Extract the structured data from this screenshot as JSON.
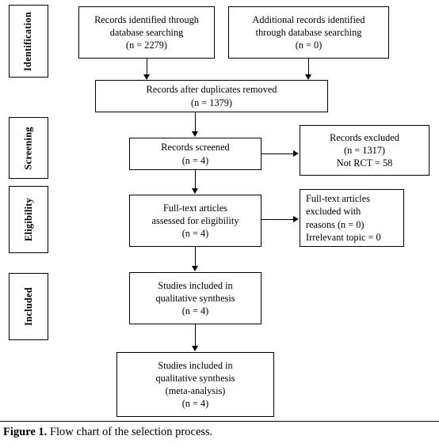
{
  "figure": {
    "caption_label": "Figure 1.",
    "caption_text": " Flow chart of the selection process."
  },
  "stages": [
    {
      "label": "Identification"
    },
    {
      "label": "Screening"
    },
    {
      "label": "Eligibility"
    },
    {
      "label": "Included"
    }
  ],
  "chart_data": {
    "type": "diagram",
    "title": "Flow chart of the selection process.",
    "diagram_kind": "PRISMA flow diagram",
    "nodes": [
      {
        "id": "records-identified",
        "stage": "Identification",
        "lines": [
          "Records identified through",
          "database searching",
          "(n = 2279)"
        ],
        "n": 2279
      },
      {
        "id": "additional-records",
        "stage": "Identification",
        "lines": [
          "Additional records identified",
          "through database searching",
          "(n = 0)"
        ],
        "n": 0
      },
      {
        "id": "duplicates-removed",
        "stage": "Identification",
        "lines": [
          "Records after duplicates removed",
          "(n = 1379)"
        ],
        "n": 1379
      },
      {
        "id": "records-screened",
        "stage": "Screening",
        "lines": [
          "Records screened",
          "(n = 4)"
        ],
        "n": 4
      },
      {
        "id": "records-excluded",
        "stage": "Screening",
        "lines": [
          "Records excluded",
          "(n = 1317)",
          "Not RCT = 58"
        ],
        "n": 1317
      },
      {
        "id": "fulltext-assessed",
        "stage": "Eligibility",
        "lines": [
          "Full-text articles",
          "assessed for eligibility",
          "(n = 4)"
        ],
        "n": 4
      },
      {
        "id": "fulltext-excluded",
        "stage": "Eligibility",
        "lines": [
          "Full-text articles",
          "excluded with",
          "reasons (n = 0)",
          "Irrelevant topic = 0"
        ],
        "n": 0
      },
      {
        "id": "qualitative-synthesis",
        "stage": "Included",
        "lines": [
          "Studies included in",
          "qualitative synthesis",
          "(n = 4)"
        ],
        "n": 4
      },
      {
        "id": "meta-analysis",
        "stage": "Included",
        "lines": [
          "Studies included in",
          "qualitative synthesis",
          "(meta-analysis)",
          "(n = 4)"
        ],
        "n": 4
      }
    ],
    "edges": [
      {
        "from": "records-identified",
        "to": "duplicates-removed",
        "direction": "down"
      },
      {
        "from": "additional-records",
        "to": "duplicates-removed",
        "direction": "down"
      },
      {
        "from": "duplicates-removed",
        "to": "records-screened",
        "direction": "down"
      },
      {
        "from": "records-screened",
        "to": "records-excluded",
        "direction": "right"
      },
      {
        "from": "records-screened",
        "to": "fulltext-assessed",
        "direction": "down"
      },
      {
        "from": "fulltext-assessed",
        "to": "fulltext-excluded",
        "direction": "right"
      },
      {
        "from": "fulltext-assessed",
        "to": "qualitative-synthesis",
        "direction": "down"
      },
      {
        "from": "qualitative-synthesis",
        "to": "meta-analysis",
        "direction": "down"
      }
    ],
    "colors": {
      "background": "#ffffff",
      "stroke": "#000000",
      "text": "#000000"
    }
  }
}
